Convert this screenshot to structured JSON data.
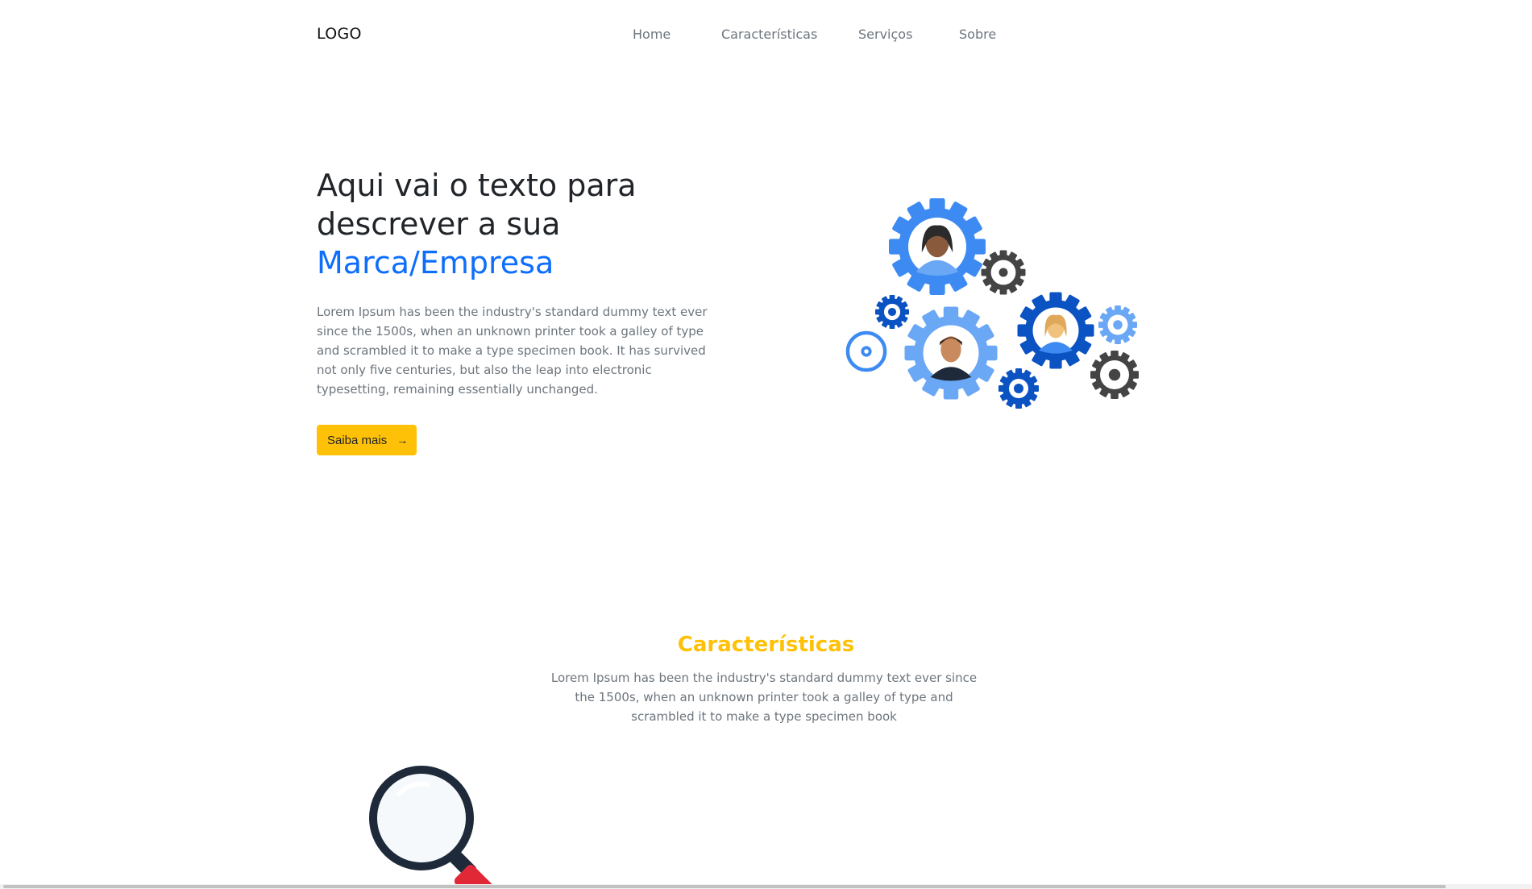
{
  "nav": {
    "logo": "LOGO",
    "items": [
      {
        "label": "Home"
      },
      {
        "label": "Características"
      },
      {
        "label": "Serviços"
      },
      {
        "label": "Sobre"
      }
    ]
  },
  "hero": {
    "title_line1": "Aqui vai o texto para",
    "title_line2": "descrever a sua",
    "title_brand": "Marca/Empresa",
    "paragraph": "Lorem Ipsum has been the industry's standard dummy text ever since the 1500s, when an unknown printer took a galley of type and scrambled it to make a type specimen book. It has survived not only five centuries, but also the leap into electronic typesetting, remaining essentially unchanged.",
    "button_label": "Saiba mais",
    "button_icon": "arrow-right-icon"
  },
  "features": {
    "title": "Características",
    "paragraph": "Lorem Ipsum has been the industry's standard dummy text ever since the 1500s, when an unknown printer took a galley of type and scrambled it to make a type specimen book"
  },
  "colors": {
    "primary": "#0d6efd",
    "accent": "#ffc107",
    "muted_text": "#6c757d",
    "gear_blue": "#3d8bf2",
    "gear_light": "#6aa7f5",
    "gear_dark_blue": "#0b52c2",
    "gear_gray": "#444444"
  }
}
